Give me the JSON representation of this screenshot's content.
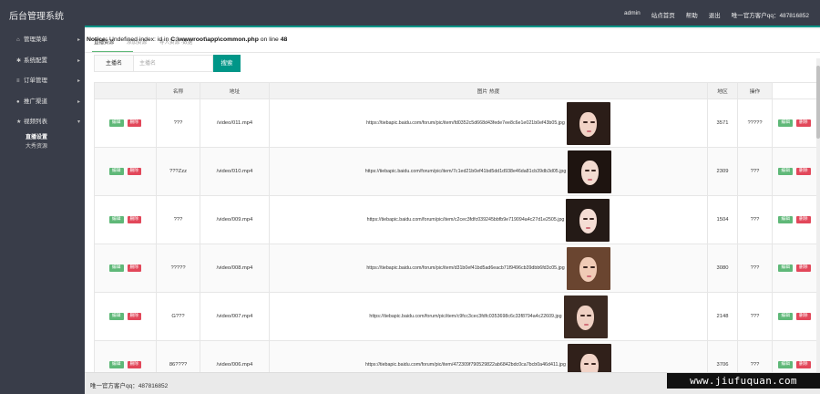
{
  "header": {
    "brand": "后台管理系统",
    "nav": [
      "admin",
      "站点首页",
      "帮助",
      "退出",
      "唯一官方客户qq：487816852"
    ]
  },
  "sidebar": {
    "items": [
      {
        "icon": "home-icon",
        "glyph": "⌂",
        "label": "管理菜单"
      },
      {
        "icon": "settings-icon",
        "glyph": "✱",
        "label": "系统配置"
      },
      {
        "icon": "cart-icon",
        "glyph": "≡",
        "label": "订单管理"
      },
      {
        "icon": "user-icon",
        "glyph": "●",
        "label": "推广渠道"
      },
      {
        "icon": "star-icon",
        "glyph": "★",
        "label": "视频列表"
      }
    ],
    "sub_items": [
      {
        "label": "直播设置",
        "active": true
      },
      {
        "label": "大秀资源",
        "active": false
      }
    ]
  },
  "error": {
    "prefix": "Notice: ",
    "message": "Undefined index: id in",
    "file": "C:\\wwwroot\\app\\common.php",
    "line_label": "on line",
    "line": "48"
  },
  "tabs": [
    "直播资源",
    "添加资源",
    "导入资源 ·数据"
  ],
  "search": {
    "label": "主播名",
    "placeholder": "主播名",
    "button": "搜索"
  },
  "table": {
    "columns": [
      "",
      "名称",
      "地址",
      "图片",
      "热度",
      "地区",
      "操作"
    ],
    "edit_label": "编辑",
    "delete_label": "删除",
    "rows": [
      {
        "name": "???",
        "addr": "/video/011.mp4",
        "url": "https://tiebapic.baidu.com/forum/pic/item/fd0352c5d668d43fede7ee8c6e1e021b0ef43b05.jpg",
        "heat": "3571",
        "region": "?????"
      },
      {
        "name": "???Zzz",
        "addr": "/video/010.mp4",
        "url": "https://tiebapic.baidu.com/forum/pic/item/7c1ed21b0ef41bd5dd1d938e46da81cb39db3d05.jpg",
        "heat": "2309",
        "region": "???"
      },
      {
        "name": "???",
        "addr": "/video/009.mp4",
        "url": "https://tiebapic.baidu.com/forum/pic/item/c2cec3fdfc039245bbfb9e719094a4c27d1e2505.jpg",
        "heat": "1504",
        "region": "???"
      },
      {
        "name": "?????",
        "addr": "/video/008.mp4",
        "url": "https://tiebapic.baidu.com/forum/pic/item/d31b0ef41bd5ad6eacb71f9496cb39dbb6fd3c05.jpg",
        "heat": "3080",
        "region": "???"
      },
      {
        "name": "G???",
        "addr": "/video/007.mp4",
        "url": "https://tiebapic.baidu.com/forum/pic/item/c9fcc3cec3fdfc0353698c6c33f8794a4c22609.jpg",
        "heat": "2148",
        "region": "???"
      },
      {
        "name": "86????",
        "addr": "/video/006.mp4",
        "url": "https://tiebapic.baidu.com/forum/pic/item/472309f790529822ab6842bdc0ca7bcb0a46d411.jpg",
        "heat": "3706",
        "region": "???"
      }
    ]
  },
  "footer": {
    "text": "唯一官方客户qq：487816852",
    "watermark": "www.jiufuquan.com"
  },
  "colors": {
    "header_bg": "#393d49",
    "accent": "#009688",
    "edit_button": "#5fb878",
    "delete_button": "#e2475a"
  }
}
